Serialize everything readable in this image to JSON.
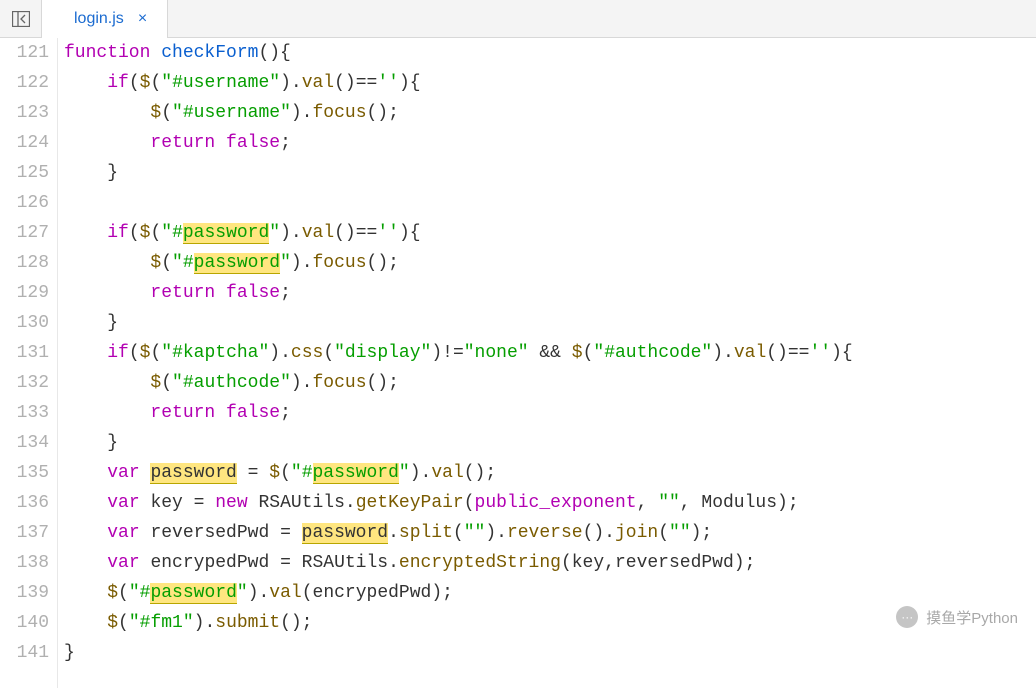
{
  "tab": {
    "filename": "login.js",
    "close_glyph": "×"
  },
  "gutter": {
    "start": 121,
    "end": 141
  },
  "code": {
    "highlight_word": "password",
    "lines": [
      [
        {
          "t": "function ",
          "c": "tok-keyword"
        },
        {
          "t": "checkForm",
          "c": "tok-deffunc"
        },
        {
          "t": "(){",
          "c": "tok-punct"
        }
      ],
      [
        {
          "t": "    ",
          "c": ""
        },
        {
          "t": "if",
          "c": "tok-keyword"
        },
        {
          "t": "(",
          "c": "tok-punct"
        },
        {
          "t": "$",
          "c": "tok-func"
        },
        {
          "t": "(",
          "c": "tok-punct"
        },
        {
          "t": "\"#username\"",
          "c": "tok-string"
        },
        {
          "t": ").",
          "c": "tok-punct"
        },
        {
          "t": "val",
          "c": "tok-func"
        },
        {
          "t": "()==",
          "c": "tok-punct"
        },
        {
          "t": "''",
          "c": "tok-string"
        },
        {
          "t": "){",
          "c": "tok-punct"
        }
      ],
      [
        {
          "t": "        ",
          "c": ""
        },
        {
          "t": "$",
          "c": "tok-func"
        },
        {
          "t": "(",
          "c": "tok-punct"
        },
        {
          "t": "\"#username\"",
          "c": "tok-string"
        },
        {
          "t": ").",
          "c": "tok-punct"
        },
        {
          "t": "focus",
          "c": "tok-func"
        },
        {
          "t": "();",
          "c": "tok-punct"
        }
      ],
      [
        {
          "t": "        ",
          "c": ""
        },
        {
          "t": "return ",
          "c": "tok-keyword"
        },
        {
          "t": "false",
          "c": "tok-keyword"
        },
        {
          "t": ";",
          "c": "tok-punct"
        }
      ],
      [
        {
          "t": "    }",
          "c": "tok-punct"
        }
      ],
      [
        {
          "t": "",
          "c": ""
        }
      ],
      [
        {
          "t": "    ",
          "c": ""
        },
        {
          "t": "if",
          "c": "tok-keyword"
        },
        {
          "t": "(",
          "c": "tok-punct"
        },
        {
          "t": "$",
          "c": "tok-func"
        },
        {
          "t": "(",
          "c": "tok-punct"
        },
        {
          "t": "\"#",
          "c": "tok-string"
        },
        {
          "t": "password",
          "c": "tok-string hl"
        },
        {
          "t": "\"",
          "c": "tok-string"
        },
        {
          "t": ").",
          "c": "tok-punct"
        },
        {
          "t": "val",
          "c": "tok-func"
        },
        {
          "t": "()==",
          "c": "tok-punct"
        },
        {
          "t": "''",
          "c": "tok-string"
        },
        {
          "t": "){",
          "c": "tok-punct"
        }
      ],
      [
        {
          "t": "        ",
          "c": ""
        },
        {
          "t": "$",
          "c": "tok-func"
        },
        {
          "t": "(",
          "c": "tok-punct"
        },
        {
          "t": "\"#",
          "c": "tok-string"
        },
        {
          "t": "password",
          "c": "tok-string hl"
        },
        {
          "t": "\"",
          "c": "tok-string"
        },
        {
          "t": ").",
          "c": "tok-punct"
        },
        {
          "t": "focus",
          "c": "tok-func"
        },
        {
          "t": "();",
          "c": "tok-punct"
        }
      ],
      [
        {
          "t": "        ",
          "c": ""
        },
        {
          "t": "return ",
          "c": "tok-keyword"
        },
        {
          "t": "false",
          "c": "tok-keyword"
        },
        {
          "t": ";",
          "c": "tok-punct"
        }
      ],
      [
        {
          "t": "    }",
          "c": "tok-punct"
        }
      ],
      [
        {
          "t": "    ",
          "c": ""
        },
        {
          "t": "if",
          "c": "tok-keyword"
        },
        {
          "t": "(",
          "c": "tok-punct"
        },
        {
          "t": "$",
          "c": "tok-func"
        },
        {
          "t": "(",
          "c": "tok-punct"
        },
        {
          "t": "\"#kaptcha\"",
          "c": "tok-string"
        },
        {
          "t": ").",
          "c": "tok-punct"
        },
        {
          "t": "css",
          "c": "tok-func"
        },
        {
          "t": "(",
          "c": "tok-punct"
        },
        {
          "t": "\"display\"",
          "c": "tok-string"
        },
        {
          "t": ")!=",
          "c": "tok-punct"
        },
        {
          "t": "\"none\"",
          "c": "tok-string"
        },
        {
          "t": " && ",
          "c": "tok-punct"
        },
        {
          "t": "$",
          "c": "tok-func"
        },
        {
          "t": "(",
          "c": "tok-punct"
        },
        {
          "t": "\"#authcode\"",
          "c": "tok-string"
        },
        {
          "t": ").",
          "c": "tok-punct"
        },
        {
          "t": "val",
          "c": "tok-func"
        },
        {
          "t": "()==",
          "c": "tok-punct"
        },
        {
          "t": "''",
          "c": "tok-string"
        },
        {
          "t": "){",
          "c": "tok-punct"
        }
      ],
      [
        {
          "t": "        ",
          "c": ""
        },
        {
          "t": "$",
          "c": "tok-func"
        },
        {
          "t": "(",
          "c": "tok-punct"
        },
        {
          "t": "\"#authcode\"",
          "c": "tok-string"
        },
        {
          "t": ").",
          "c": "tok-punct"
        },
        {
          "t": "focus",
          "c": "tok-func"
        },
        {
          "t": "();",
          "c": "tok-punct"
        }
      ],
      [
        {
          "t": "        ",
          "c": ""
        },
        {
          "t": "return ",
          "c": "tok-keyword"
        },
        {
          "t": "false",
          "c": "tok-keyword"
        },
        {
          "t": ";",
          "c": "tok-punct"
        }
      ],
      [
        {
          "t": "    }",
          "c": "tok-punct"
        }
      ],
      [
        {
          "t": "    ",
          "c": ""
        },
        {
          "t": "var ",
          "c": "tok-keyword"
        },
        {
          "t": "password",
          "c": "tok-var hl"
        },
        {
          "t": " = ",
          "c": "tok-punct"
        },
        {
          "t": "$",
          "c": "tok-func"
        },
        {
          "t": "(",
          "c": "tok-punct"
        },
        {
          "t": "\"#",
          "c": "tok-string"
        },
        {
          "t": "password",
          "c": "tok-string hl"
        },
        {
          "t": "\"",
          "c": "tok-string"
        },
        {
          "t": ").",
          "c": "tok-punct"
        },
        {
          "t": "val",
          "c": "tok-func"
        },
        {
          "t": "();",
          "c": "tok-punct"
        }
      ],
      [
        {
          "t": "    ",
          "c": ""
        },
        {
          "t": "var ",
          "c": "tok-keyword"
        },
        {
          "t": "key",
          "c": "tok-var"
        },
        {
          "t": " = ",
          "c": "tok-punct"
        },
        {
          "t": "new ",
          "c": "tok-keyword"
        },
        {
          "t": "RSAUtils",
          "c": "tok-var"
        },
        {
          "t": ".",
          "c": "tok-punct"
        },
        {
          "t": "getKeyPair",
          "c": "tok-func"
        },
        {
          "t": "(",
          "c": "tok-punct"
        },
        {
          "t": "public_exponent",
          "c": "tok-keyword"
        },
        {
          "t": ", ",
          "c": "tok-punct"
        },
        {
          "t": "\"\"",
          "c": "tok-string"
        },
        {
          "t": ", ",
          "c": "tok-punct"
        },
        {
          "t": "Modulus",
          "c": "tok-var"
        },
        {
          "t": ");",
          "c": "tok-punct"
        }
      ],
      [
        {
          "t": "    ",
          "c": ""
        },
        {
          "t": "var ",
          "c": "tok-keyword"
        },
        {
          "t": "reversedPwd",
          "c": "tok-var"
        },
        {
          "t": " = ",
          "c": "tok-punct"
        },
        {
          "t": "password",
          "c": "tok-var hl"
        },
        {
          "t": ".",
          "c": "tok-punct"
        },
        {
          "t": "split",
          "c": "tok-func"
        },
        {
          "t": "(",
          "c": "tok-punct"
        },
        {
          "t": "\"\"",
          "c": "tok-string"
        },
        {
          "t": ").",
          "c": "tok-punct"
        },
        {
          "t": "reverse",
          "c": "tok-func"
        },
        {
          "t": "().",
          "c": "tok-punct"
        },
        {
          "t": "join",
          "c": "tok-func"
        },
        {
          "t": "(",
          "c": "tok-punct"
        },
        {
          "t": "\"\"",
          "c": "tok-string"
        },
        {
          "t": ");",
          "c": "tok-punct"
        }
      ],
      [
        {
          "t": "    ",
          "c": ""
        },
        {
          "t": "var ",
          "c": "tok-keyword"
        },
        {
          "t": "encrypedPwd",
          "c": "tok-var"
        },
        {
          "t": " = ",
          "c": "tok-punct"
        },
        {
          "t": "RSAUtils",
          "c": "tok-var"
        },
        {
          "t": ".",
          "c": "tok-punct"
        },
        {
          "t": "encryptedString",
          "c": "tok-func"
        },
        {
          "t": "(",
          "c": "tok-punct"
        },
        {
          "t": "key",
          "c": "tok-var"
        },
        {
          "t": ",",
          "c": "tok-punct"
        },
        {
          "t": "reversedPwd",
          "c": "tok-var"
        },
        {
          "t": ");",
          "c": "tok-punct"
        }
      ],
      [
        {
          "t": "    ",
          "c": ""
        },
        {
          "t": "$",
          "c": "tok-func"
        },
        {
          "t": "(",
          "c": "tok-punct"
        },
        {
          "t": "\"#",
          "c": "tok-string"
        },
        {
          "t": "password",
          "c": "tok-string hl"
        },
        {
          "t": "\"",
          "c": "tok-string"
        },
        {
          "t": ").",
          "c": "tok-punct"
        },
        {
          "t": "val",
          "c": "tok-func"
        },
        {
          "t": "(",
          "c": "tok-punct"
        },
        {
          "t": "encrypedPwd",
          "c": "tok-var"
        },
        {
          "t": ");",
          "c": "tok-punct"
        }
      ],
      [
        {
          "t": "    ",
          "c": ""
        },
        {
          "t": "$",
          "c": "tok-func"
        },
        {
          "t": "(",
          "c": "tok-punct"
        },
        {
          "t": "\"#fm1\"",
          "c": "tok-string"
        },
        {
          "t": ").",
          "c": "tok-punct"
        },
        {
          "t": "submit",
          "c": "tok-func"
        },
        {
          "t": "();",
          "c": "tok-punct"
        }
      ],
      [
        {
          "t": "}",
          "c": "tok-punct"
        }
      ]
    ]
  },
  "watermark": {
    "icon_glyph": "👤",
    "text": "摸鱼学Python"
  }
}
